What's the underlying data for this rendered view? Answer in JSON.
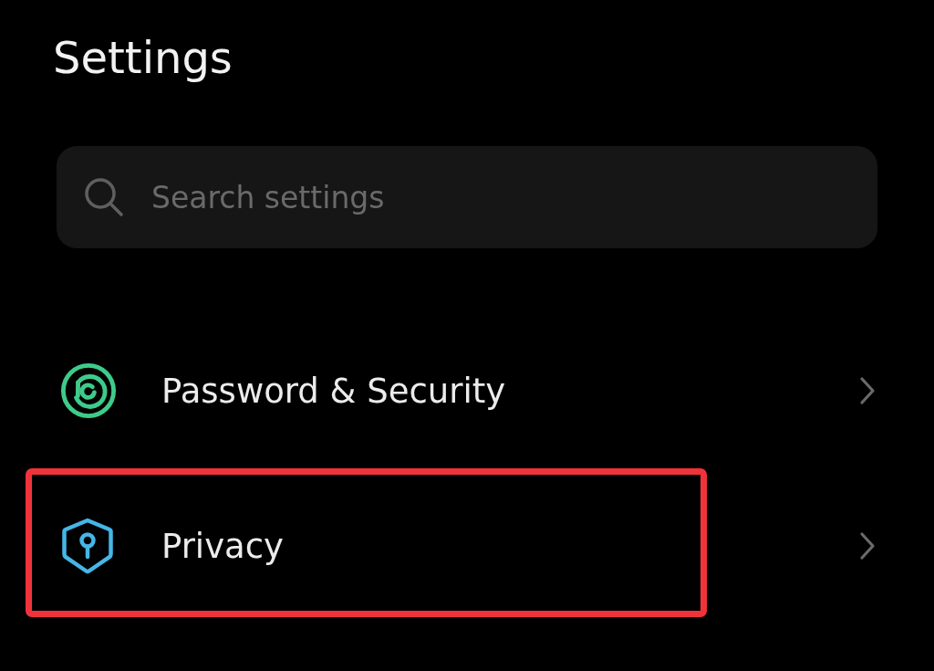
{
  "title": "Settings",
  "search": {
    "placeholder": "Search settings"
  },
  "items": [
    {
      "kind": "security",
      "label": "Password & Security",
      "highlighted": false
    },
    {
      "kind": "privacy",
      "label": "Privacy",
      "highlighted": true
    }
  ]
}
